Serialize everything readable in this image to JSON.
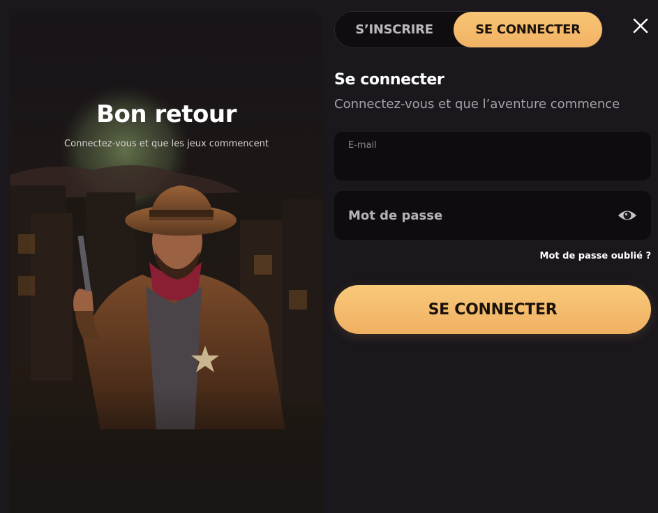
{
  "hero": {
    "title": "Bon retour",
    "subtitle": "Connectez-vous et que les jeux commencent"
  },
  "tabs": {
    "signup": "S’INSCRIRE",
    "login": "SE CONNECTER",
    "active": "login"
  },
  "form": {
    "title": "Se connecter",
    "subtitle": "Connectez-vous et que l’aventure commence",
    "email_label": "E-mail",
    "email_value": "",
    "password_placeholder": "Mot de passe",
    "forgot_link": "Mot de passe oublié ?",
    "submit_label": "SE CONNECTER"
  },
  "icons": {
    "close": "close-icon",
    "eye": "eye-icon"
  },
  "colors": {
    "accent": "#f4b968",
    "background": "#1b181d",
    "field": "#0e0c0f"
  }
}
